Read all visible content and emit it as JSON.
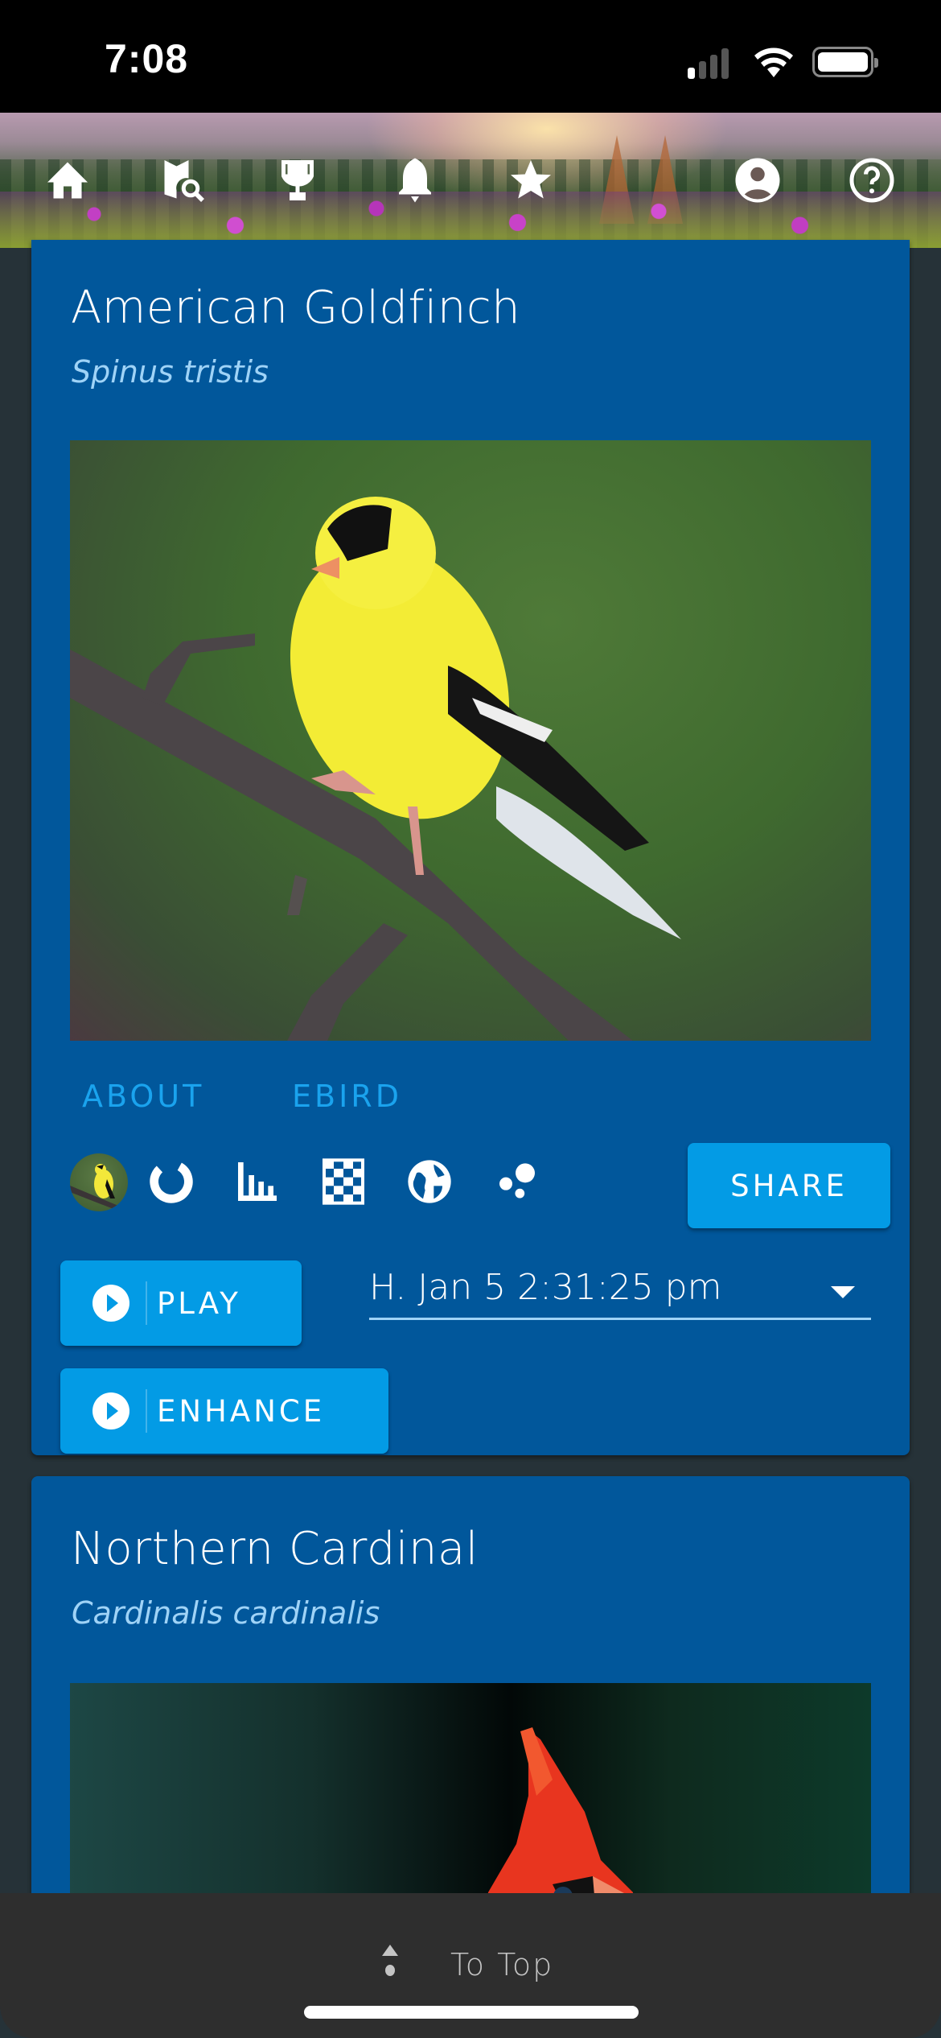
{
  "status_bar": {
    "time": "7:08",
    "signal_bars_active": 1,
    "signal_bars_total": 4,
    "wifi": "wifi-icon",
    "battery": "battery-icon"
  },
  "nav": {
    "items": [
      {
        "name": "home",
        "icon": "home-icon"
      },
      {
        "name": "map-search",
        "icon": "map-search-icon"
      },
      {
        "name": "trophy",
        "icon": "trophy-icon"
      },
      {
        "name": "notifications",
        "icon": "bell-icon"
      },
      {
        "name": "favorites",
        "icon": "star-icon"
      },
      {
        "name": "account",
        "icon": "account-circle-icon"
      },
      {
        "name": "help",
        "icon": "help-circle-icon"
      }
    ]
  },
  "cards": [
    {
      "common_name": "American Goldfinch",
      "scientific_name": "Spinus tristis",
      "image_alt": "American Goldfinch perched on a branch",
      "tabs": [
        "ABOUT",
        "EBIRD"
      ],
      "tools": [
        {
          "name": "bird-avatar",
          "icon": "bird-avatar-icon"
        },
        {
          "name": "donut",
          "icon": "donut-chart-icon"
        },
        {
          "name": "bar-chart",
          "icon": "bar-chart-icon"
        },
        {
          "name": "checkerboard",
          "icon": "checkerboard-icon"
        },
        {
          "name": "globe",
          "icon": "globe-icon"
        },
        {
          "name": "bubbles",
          "icon": "bubble-chart-icon"
        }
      ],
      "share_label": "SHARE",
      "play_label": "PLAY",
      "enhance_label": "ENHANCE",
      "recording_select": {
        "value": "H. Jan 5 2:31:25 pm"
      }
    },
    {
      "common_name": "Northern Cardinal",
      "scientific_name": "Cardinalis cardinalis",
      "image_alt": "Northern Cardinal"
    }
  ],
  "bottom_bar": {
    "to_top_label": "To Top"
  },
  "colors": {
    "card_bg": "#01579b",
    "accent_button": "#039be5",
    "tab_text": "#1aa3ee",
    "page_bg": "#263238",
    "bottom_bar_bg": "#2e2e2e"
  }
}
